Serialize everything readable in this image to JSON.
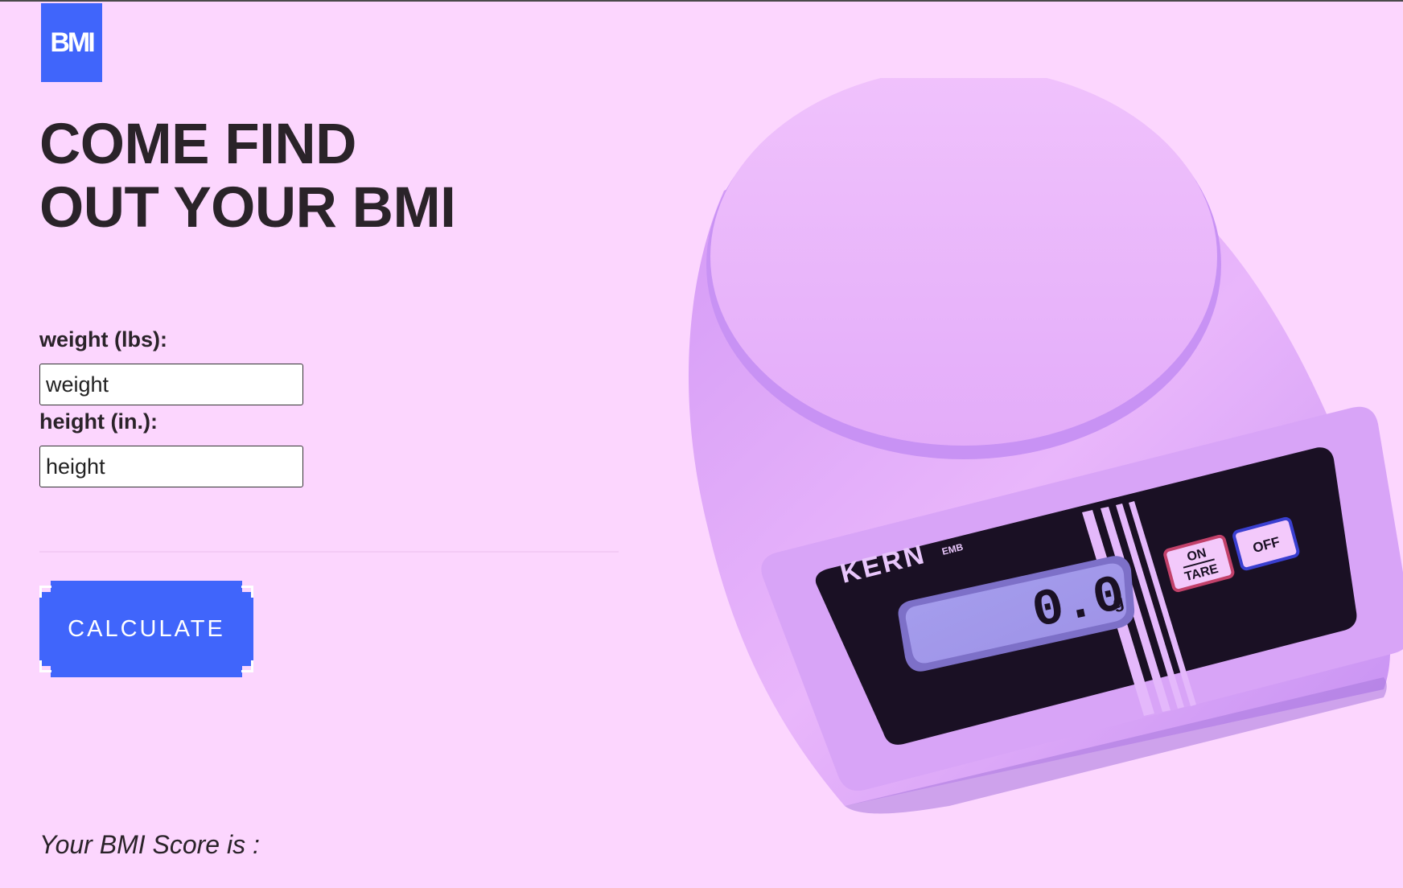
{
  "logo": {
    "text": "BMI",
    "color": "#4065fb"
  },
  "headline": "COME FIND OUT YOUR BMI",
  "form": {
    "weight_label": "weight (lbs):",
    "weight_placeholder": "weight",
    "height_label": "height (in.):",
    "height_placeholder": "height"
  },
  "calculate_label": "CALCULATE",
  "result": {
    "label": "Your BMI Score is :",
    "value": ""
  },
  "scale_image": {
    "brand": "KERN",
    "model": "EMB",
    "display_value": "0.0",
    "display_unit": "g",
    "buttons": {
      "on": "ON",
      "tare": "TARE",
      "off": "OFF"
    }
  },
  "colors": {
    "background": "#fcd6fe",
    "accent": "#4065fb",
    "text": "#2a2329"
  }
}
